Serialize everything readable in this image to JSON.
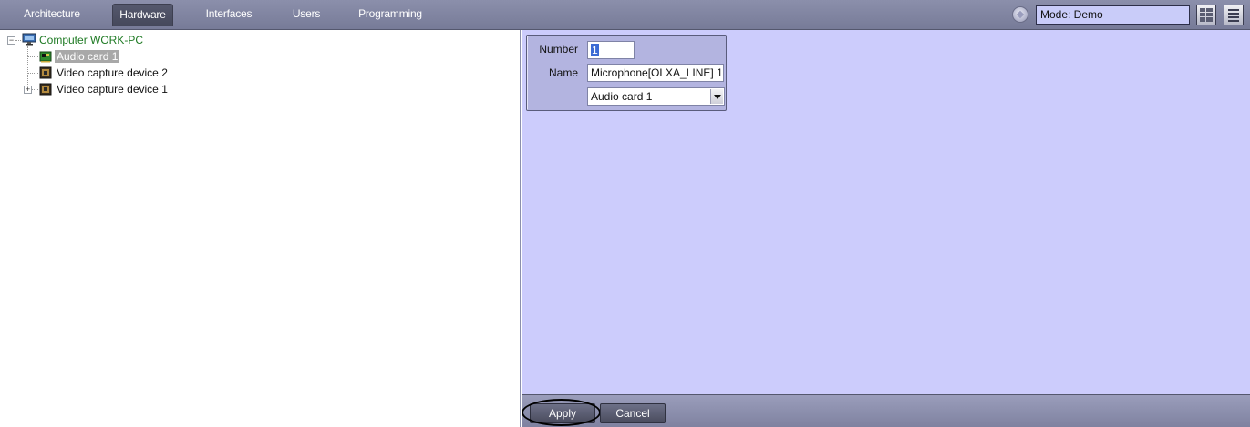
{
  "tabs": [
    {
      "label": "Architecture"
    },
    {
      "label": "Hardware",
      "active": true
    },
    {
      "label": "Interfaces"
    },
    {
      "label": "Users"
    },
    {
      "label": "Programming"
    }
  ],
  "toolbar": {
    "mode_text": "Mode: Demo",
    "mode_icon": "mode-settings-icon",
    "layout_icon": "layout-grid-icon",
    "menu_icon": "menu-list-icon"
  },
  "tree": {
    "root": {
      "label": "Computer WORK-PC",
      "icon": "computer-icon",
      "expander": "−"
    },
    "items": [
      {
        "label": "Audio card 1",
        "icon": "audio-card-icon",
        "selected": true
      },
      {
        "label": "Video capture device 2",
        "icon": "video-capture-icon"
      },
      {
        "label": "Video capture device 1",
        "icon": "video-capture-icon",
        "expander": "+"
      }
    ]
  },
  "settings": {
    "number_label": "Number",
    "number_value": "1",
    "name_label": "Name",
    "name_value": "Microphone[OLXA_LINE] 1",
    "parent_value": "Audio card 1"
  },
  "actions": {
    "apply_label": "Apply",
    "cancel_label": "Cancel"
  },
  "colors": {
    "topbar": "#7f83a0",
    "panel": "#ccccfc",
    "group": "#b3b4e0",
    "computer_label": "#1e7a23"
  }
}
